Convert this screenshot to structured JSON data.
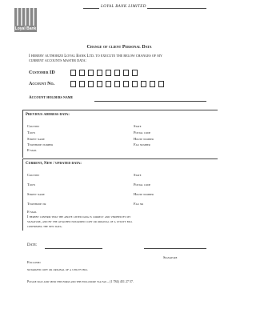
{
  "header": {
    "brand_line": "LOYAL BANK LIMITED",
    "logo_text": "Loyal Bank"
  },
  "form": {
    "title": "Change of client Personal Data",
    "intro_1": "I hereby authorize Loyal Bank Ltd. to execute the below changes of my",
    "intro_2": "current accounts master data:",
    "customer_id_label": "Customer ID",
    "account_no_label": "Account No.",
    "holders_label": "Account holders name"
  },
  "previous": {
    "heading": "Previous address data:",
    "left": [
      "Country",
      "Town",
      "Street name",
      "Telephone number",
      "E-mail"
    ],
    "right": [
      "State",
      "Postal code",
      "House number",
      "Fax number"
    ]
  },
  "current": {
    "heading": "Current, New / updated data:",
    "left": [
      "Country",
      "Town",
      "Street name",
      "Telephone nr"
    ],
    "right": [
      "State",
      "Postal code",
      "House number",
      "Fax nr"
    ],
    "email": "E-mail",
    "confirm_1": "I hereby confirm that the above listed data is correct and verified by my",
    "confirm_2": "signature, and by the attached notarized copy or original of a utility bill",
    "confirm_3": "confirming the new data."
  },
  "signoff": {
    "date_label": "Date:",
    "signature_label": "Signature",
    "enclosed": "Enclosed",
    "notarized": "notarized copy or original of a utility bill",
    "footer": "Please sign and send this form and the enclosure via fax – (1 784) 451 27 57."
  }
}
